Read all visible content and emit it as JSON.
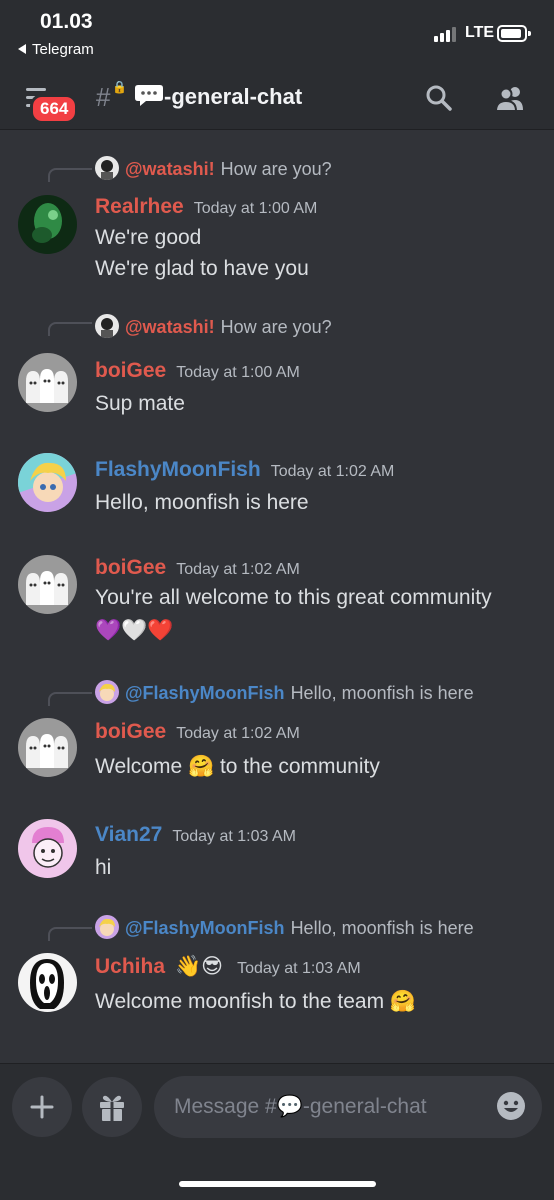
{
  "status_bar": {
    "time": "01.03",
    "back_app": "Telegram",
    "network": "LTE"
  },
  "header": {
    "unread_badge": "664",
    "channel_name": "-general-chat"
  },
  "colors": {
    "background": "#313338",
    "header": "#2b2d31",
    "mention_red": "#e05a4e",
    "name_blue": "#4b87c7",
    "badge": "#f23f43"
  },
  "messages": [
    {
      "reply": {
        "name": "@watashi!",
        "text": "How are you?"
      },
      "author": "Realrhee",
      "time": "Today at 1:00 AM",
      "lines": [
        "We're good",
        "We're glad to have you"
      ]
    },
    {
      "reply": {
        "name": "@watashi!",
        "text": "How are you?"
      },
      "author": "boiGee",
      "time": "Today at 1:00 AM",
      "lines": [
        "Sup mate"
      ]
    },
    {
      "author": "FlashyMoonFish",
      "time": "Today at 1:02 AM",
      "lines": [
        "Hello, moonfish is here"
      ]
    },
    {
      "author": "boiGee",
      "time": "Today at 1:02 AM",
      "lines": [
        "You're all welcome to this great community",
        "💜🤍❤️"
      ]
    },
    {
      "reply": {
        "name": "@FlashyMoonFish",
        "text": "Hello, moonfish is here"
      },
      "author": "boiGee",
      "time": "Today at 1:02 AM",
      "lines": [
        "Welcome 🤗 to the community"
      ]
    },
    {
      "author": "Vian27",
      "time": "Today at 1:03 AM",
      "lines": [
        "hi"
      ]
    },
    {
      "reply": {
        "name": "@FlashyMoonFish",
        "text": "Hello, moonfish is here"
      },
      "author": "Uchiha",
      "author_emoji": "👋😎",
      "time": "Today at 1:03 AM",
      "lines": [
        "Welcome moonfish to the team 🤗"
      ]
    }
  ],
  "composer": {
    "placeholder": "Message #💬-general-chat"
  },
  "icons": [
    "menu-icon",
    "hash-lock-icon",
    "speech-bubble-icon",
    "search-icon",
    "members-icon",
    "plus-icon",
    "gift-icon",
    "smiley-icon"
  ]
}
